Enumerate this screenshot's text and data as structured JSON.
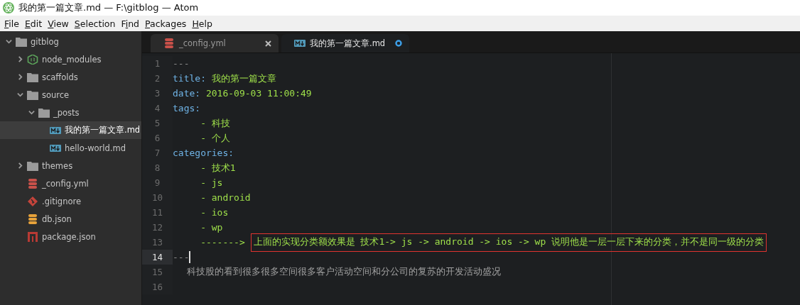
{
  "window": {
    "title": "我的第一篇文章.md — F:\\gitblog — Atom"
  },
  "menu": [
    {
      "key": "F",
      "post": "ile"
    },
    {
      "key": "E",
      "post": "dit"
    },
    {
      "key": "V",
      "post": "iew"
    },
    {
      "key": "S",
      "post": "election"
    },
    {
      "pre": "F",
      "key": "i",
      "post": "nd"
    },
    {
      "key": "P",
      "post": "ackages"
    },
    {
      "key": "H",
      "post": "elp"
    }
  ],
  "tree": [
    {
      "name": "gitblog",
      "kind": "folder",
      "expanded": true,
      "selected": false,
      "children": [
        {
          "name": "node_modules",
          "kind": "modules",
          "expanded": false,
          "selected": false
        },
        {
          "name": "scaffolds",
          "kind": "folder",
          "expanded": false,
          "selected": false
        },
        {
          "name": "source",
          "kind": "folder",
          "expanded": true,
          "selected": false,
          "children": [
            {
              "name": "_posts",
              "kind": "folder",
              "expanded": true,
              "selected": false,
              "children": [
                {
                  "name": "我的第一篇文章.md",
                  "kind": "markdown",
                  "selected": true
                },
                {
                  "name": "hello-world.md",
                  "kind": "markdown",
                  "selected": false
                }
              ]
            }
          ]
        },
        {
          "name": "themes",
          "kind": "folder",
          "expanded": false,
          "selected": false
        },
        {
          "name": "_config.yml",
          "kind": "config",
          "selected": false
        },
        {
          "name": ".gitignore",
          "kind": "git",
          "selected": false
        },
        {
          "name": "db.json",
          "kind": "data",
          "selected": false
        },
        {
          "name": "package.json",
          "kind": "npm",
          "selected": false
        }
      ]
    }
  ],
  "tabs": [
    {
      "label": "_config.yml",
      "kind": "config",
      "selected": false,
      "modified": false
    },
    {
      "label": "我的第一篇文章.md",
      "kind": "markdown",
      "selected": true,
      "modified": true
    }
  ],
  "editor": {
    "lines": [
      {
        "number": "1",
        "current": false,
        "segments": [
          {
            "kind": "punct",
            "text": "---"
          }
        ]
      },
      {
        "number": "2",
        "current": false,
        "segments": [
          {
            "kind": "key",
            "text": "title: "
          },
          {
            "kind": "value",
            "text": "我的第一篇文章"
          }
        ]
      },
      {
        "number": "3",
        "current": false,
        "segments": [
          {
            "kind": "key",
            "text": "date: "
          },
          {
            "kind": "value",
            "text": "2016-09-03 11:00:49"
          }
        ]
      },
      {
        "number": "4",
        "current": false,
        "segments": [
          {
            "kind": "key",
            "text": "tags:"
          }
        ]
      },
      {
        "number": "5",
        "current": false,
        "segments": [
          {
            "kind": "value",
            "text": "     - 科技"
          }
        ]
      },
      {
        "number": "6",
        "current": false,
        "segments": [
          {
            "kind": "value",
            "text": "     - 个人"
          }
        ]
      },
      {
        "number": "7",
        "current": false,
        "segments": [
          {
            "kind": "key",
            "text": "categories:"
          }
        ]
      },
      {
        "number": "8",
        "current": false,
        "segments": [
          {
            "kind": "value",
            "text": "     - 技术1"
          }
        ]
      },
      {
        "number": "9",
        "current": false,
        "segments": [
          {
            "kind": "value",
            "text": "     - js"
          }
        ]
      },
      {
        "number": "10",
        "current": false,
        "segments": [
          {
            "kind": "value",
            "text": "     - android"
          }
        ]
      },
      {
        "number": "11",
        "current": false,
        "segments": [
          {
            "kind": "value",
            "text": "     - ios"
          }
        ]
      },
      {
        "number": "12",
        "current": false,
        "segments": [
          {
            "kind": "value",
            "text": "     - wp"
          }
        ]
      },
      {
        "number": "13",
        "current": false,
        "segments": [
          {
            "kind": "value",
            "text": "     -------> "
          }
        ],
        "annotation": "上面的实现分类额效果是  技术1-> js -> android -> ios -> wp 说明他是一层一层下来的分类，并不是同一级的分类"
      },
      {
        "number": "14",
        "current": true,
        "segments": [
          {
            "kind": "punct",
            "text": "---"
          }
        ]
      },
      {
        "number": "15",
        "current": false,
        "segments": [
          {
            "kind": "plain",
            "text": "     科技股的看到很多很多空间很多客户活动空间和分公司的复苏的开发活动盛况"
          }
        ]
      },
      {
        "number": "16",
        "current": false
      }
    ]
  }
}
